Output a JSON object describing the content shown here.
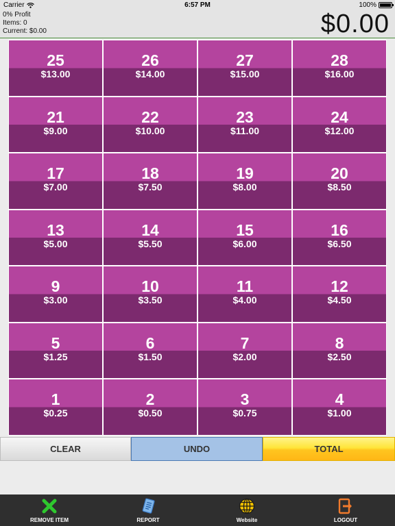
{
  "status_bar": {
    "carrier": "Carrier",
    "time": "6:57 PM",
    "battery": "100%"
  },
  "header": {
    "profit": "0% Profit",
    "items": "Items: 0",
    "current": "Current: $0.00",
    "total": "$0.00"
  },
  "grid": [
    {
      "number": "25",
      "price": "$13.00"
    },
    {
      "number": "26",
      "price": "$14.00"
    },
    {
      "number": "27",
      "price": "$15.00"
    },
    {
      "number": "28",
      "price": "$16.00"
    },
    {
      "number": "21",
      "price": "$9.00"
    },
    {
      "number": "22",
      "price": "$10.00"
    },
    {
      "number": "23",
      "price": "$11.00"
    },
    {
      "number": "24",
      "price": "$12.00"
    },
    {
      "number": "17",
      "price": "$7.00"
    },
    {
      "number": "18",
      "price": "$7.50"
    },
    {
      "number": "19",
      "price": "$8.00"
    },
    {
      "number": "20",
      "price": "$8.50"
    },
    {
      "number": "13",
      "price": "$5.00"
    },
    {
      "number": "14",
      "price": "$5.50"
    },
    {
      "number": "15",
      "price": "$6.00"
    },
    {
      "number": "16",
      "price": "$6.50"
    },
    {
      "number": "9",
      "price": "$3.00"
    },
    {
      "number": "10",
      "price": "$3.50"
    },
    {
      "number": "11",
      "price": "$4.00"
    },
    {
      "number": "12",
      "price": "$4.50"
    },
    {
      "number": "5",
      "price": "$1.25"
    },
    {
      "number": "6",
      "price": "$1.50"
    },
    {
      "number": "7",
      "price": "$2.00"
    },
    {
      "number": "8",
      "price": "$2.50"
    },
    {
      "number": "1",
      "price": "$0.25"
    },
    {
      "number": "2",
      "price": "$0.50"
    },
    {
      "number": "3",
      "price": "$0.75"
    },
    {
      "number": "4",
      "price": "$1.00"
    }
  ],
  "actions": {
    "clear": "CLEAR",
    "undo": "UNDO",
    "total": "TOTAL"
  },
  "tabbar": {
    "remove_item": "REMOVE ITEM",
    "report": "REPORT",
    "website": "Website",
    "logout": "LOGOUT"
  },
  "colors": {
    "tile_top": "#b4449e",
    "tile_bottom": "#7c2a6e",
    "undo": "#a4c2e6",
    "total": "#ffd42a",
    "tabbar": "#2f2f2f"
  },
  "icons": {
    "remove_item": "close-x-icon",
    "report": "document-icon",
    "website": "globe-icon",
    "logout": "logout-icon"
  }
}
